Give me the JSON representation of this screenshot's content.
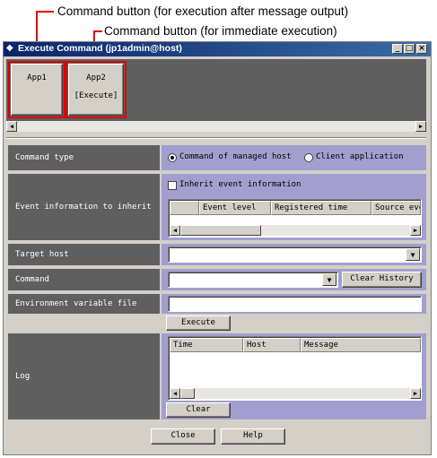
{
  "callouts": {
    "top": "Command button (for execution after message output)",
    "second": "Command button (for immediate execution)"
  },
  "window": {
    "title": "Execute Command (jp1admin@host)"
  },
  "command_buttons": [
    {
      "name": "App1",
      "subtitle": ""
    },
    {
      "name": "App2",
      "subtitle": "[Execute]"
    }
  ],
  "form": {
    "command_type": {
      "label": "Command type",
      "options": [
        "Command of managed host",
        "Client application"
      ],
      "selected": "Command of managed host"
    },
    "event_info": {
      "label": "Event information to inherit",
      "checkbox_label": "Inherit event information",
      "columns": [
        "",
        "Event level",
        "Registered time",
        "Source eve"
      ]
    },
    "target_host": {
      "label": "Target host",
      "value": ""
    },
    "command": {
      "label": "Command",
      "value": "",
      "clear_history": "Clear History"
    },
    "env_file": {
      "label": "Environment variable file",
      "value": ""
    },
    "execute": "Execute",
    "log": {
      "label": "Log",
      "columns": [
        "Time",
        "Host",
        "Message"
      ],
      "clear": "Clear"
    }
  },
  "footer": {
    "close": "Close",
    "help": "Help"
  }
}
